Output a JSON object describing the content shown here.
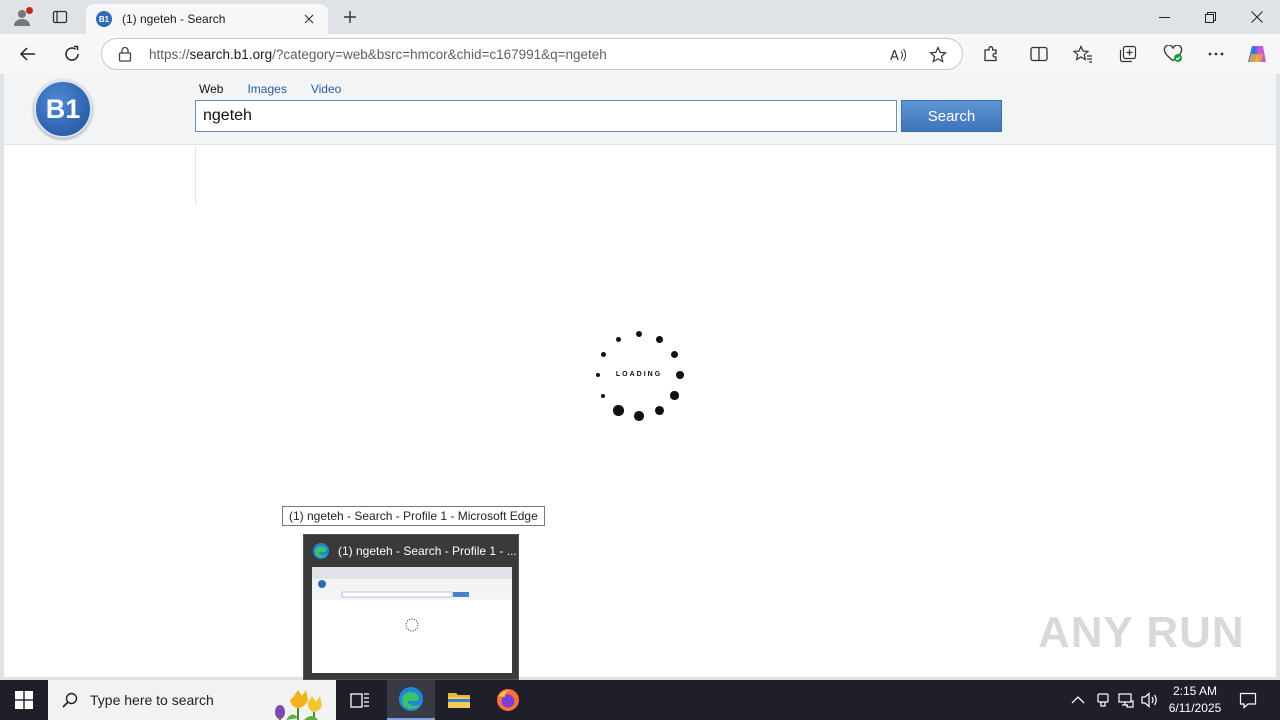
{
  "browser": {
    "tab_title": "(1) ngeteh - Search",
    "favicon_text": "B1",
    "url_scheme": "https://",
    "url_host": "search.b1.org",
    "url_path": "/?category=web&bsrc=hmcor&chid=c167991&q=ngeteh",
    "icons": [
      "profile-icon",
      "tab-actions-icon",
      "close-icon",
      "plus-icon",
      "minimize-icon",
      "restore-icon",
      "back-icon",
      "refresh-icon",
      "lock-icon",
      "read-aloud-icon",
      "star-icon",
      "extensions-icon",
      "split-screen-icon",
      "favorites-icon",
      "collections-icon",
      "browser-essentials-icon",
      "more-icon",
      "copilot-icon"
    ]
  },
  "page": {
    "logo_text": "B1",
    "categories": [
      {
        "label": "Web",
        "active": true
      },
      {
        "label": "Images",
        "active": false
      },
      {
        "label": "Video",
        "active": false
      }
    ],
    "query": "ngeteh",
    "search_button": "Search",
    "loading_text": "LOADING"
  },
  "tooltip": "(1) ngeteh - Search - Profile 1 - Microsoft Edge",
  "thumbnail": {
    "title": "(1) ngeteh - Search - Profile 1 - ..."
  },
  "watermark": "ANY RUN",
  "taskbar": {
    "search_placeholder": "Type here to search",
    "time": "2:15 AM",
    "date": "6/11/2025",
    "apps": [
      "task-view-icon",
      "edge-icon",
      "file-explorer-icon",
      "firefox-icon"
    ]
  },
  "colors": {
    "accent": "#3d74bb",
    "link": "#2a5aa0",
    "taskbar": "#1f1f2a",
    "chrome": "#dfe3e8"
  }
}
